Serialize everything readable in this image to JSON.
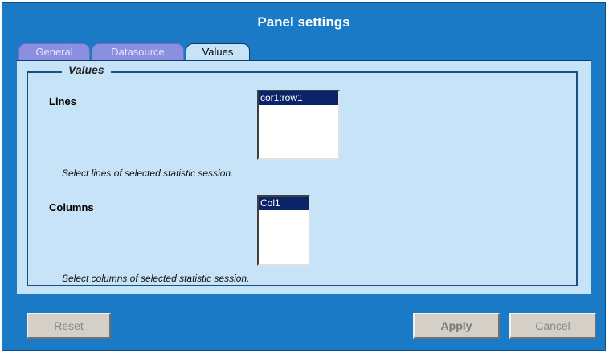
{
  "dialog": {
    "title": "Panel settings"
  },
  "tabs": [
    {
      "label": "General",
      "active": false
    },
    {
      "label": "Datasource",
      "active": false
    },
    {
      "label": "Values",
      "active": true
    }
  ],
  "values_section": {
    "legend": "Values",
    "lines": {
      "label": "Lines",
      "selected_option": "cor1:row1",
      "hint": "Select lines of selected statistic session."
    },
    "columns": {
      "label": "Columns",
      "selected_option": "Col1",
      "hint": "Select columns of selected statistic session."
    }
  },
  "buttons": {
    "reset": "Reset",
    "apply": "Apply",
    "cancel": "Cancel"
  },
  "colors": {
    "dialog_background": "#1a7ac6",
    "panel_background": "#c6e3f7",
    "inactive_tab": "#8a8fe0",
    "selection": "#0a246a",
    "button_face": "#d4d0c8"
  }
}
